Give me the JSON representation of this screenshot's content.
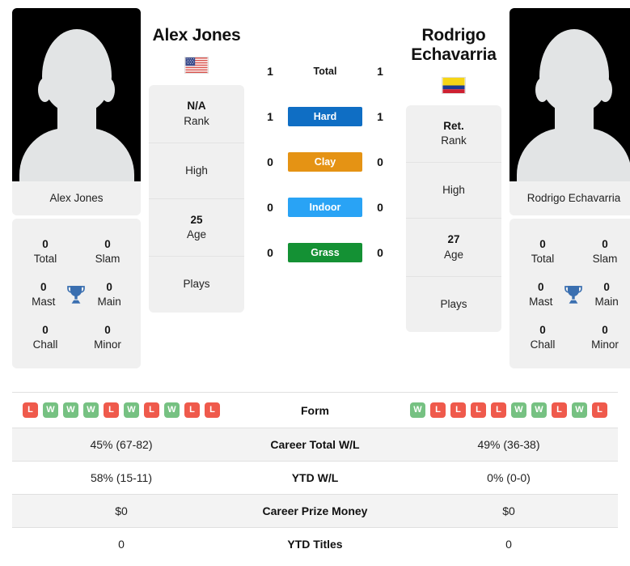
{
  "players": {
    "left": {
      "name": "Alex Jones",
      "flag": "us-flag-icon",
      "avatar_name": "Alex Jones",
      "rank": "N/A",
      "rank_label": "Rank",
      "high_label": "High",
      "age": "25",
      "age_label": "Age",
      "plays_label": "Plays",
      "trophies": {
        "total": "0",
        "total_label": "Total",
        "slam": "0",
        "slam_label": "Slam",
        "mast": "0",
        "mast_label": "Mast",
        "main": "0",
        "main_label": "Main",
        "chall": "0",
        "chall_label": "Chall",
        "minor": "0",
        "minor_label": "Minor"
      },
      "form": [
        "L",
        "W",
        "W",
        "W",
        "L",
        "W",
        "L",
        "W",
        "L",
        "L"
      ],
      "career_total_wl": "45% (67-82)",
      "ytd_wl": "58% (15-11)",
      "career_prize_money": "$0",
      "ytd_titles": "0"
    },
    "right": {
      "name": "Rodrigo Echavarria",
      "flag": "colombia-flag-icon",
      "avatar_name": "Rodrigo Echavarria",
      "rank": "Ret.",
      "rank_label": "Rank",
      "high_label": "High",
      "age": "27",
      "age_label": "Age",
      "plays_label": "Plays",
      "trophies": {
        "total": "0",
        "total_label": "Total",
        "slam": "0",
        "slam_label": "Slam",
        "mast": "0",
        "mast_label": "Mast",
        "main": "0",
        "main_label": "Main",
        "chall": "0",
        "chall_label": "Chall",
        "minor": "0",
        "minor_label": "Minor"
      },
      "form": [
        "W",
        "L",
        "L",
        "L",
        "L",
        "W",
        "W",
        "L",
        "W",
        "L"
      ],
      "career_total_wl": "49% (36-38)",
      "ytd_wl": "0% (0-0)",
      "career_prize_money": "$0",
      "ytd_titles": "0"
    }
  },
  "h2h": [
    {
      "label": "Total",
      "left": "1",
      "right": "1",
      "color": "",
      "plain": true
    },
    {
      "label": "Hard",
      "left": "1",
      "right": "1",
      "color": "#0f6ec4",
      "plain": false
    },
    {
      "label": "Clay",
      "left": "0",
      "right": "0",
      "color": "#e59314",
      "plain": false
    },
    {
      "label": "Indoor",
      "left": "0",
      "right": "0",
      "color": "#29a3f5",
      "plain": false
    },
    {
      "label": "Grass",
      "left": "0",
      "right": "0",
      "color": "#149134",
      "plain": false
    }
  ],
  "table": {
    "rows": [
      {
        "label": "Form",
        "type": "form",
        "left": "",
        "right": ""
      },
      {
        "label": "Career Total W/L",
        "type": "text",
        "left": "45% (67-82)",
        "right": "49% (36-38)"
      },
      {
        "label": "YTD W/L",
        "type": "text",
        "left": "58% (15-11)",
        "right": "0% (0-0)"
      },
      {
        "label": "Career Prize Money",
        "type": "text",
        "left": "$0",
        "right": "$0"
      },
      {
        "label": "YTD Titles",
        "type": "text",
        "left": "0",
        "right": "0"
      }
    ]
  },
  "colors": {
    "win": "#76c182",
    "loss": "#ef5a4c",
    "trophy": "#3a6fb0",
    "card_bg": "#f0f0f0",
    "row_alt": "#f3f3f3"
  }
}
